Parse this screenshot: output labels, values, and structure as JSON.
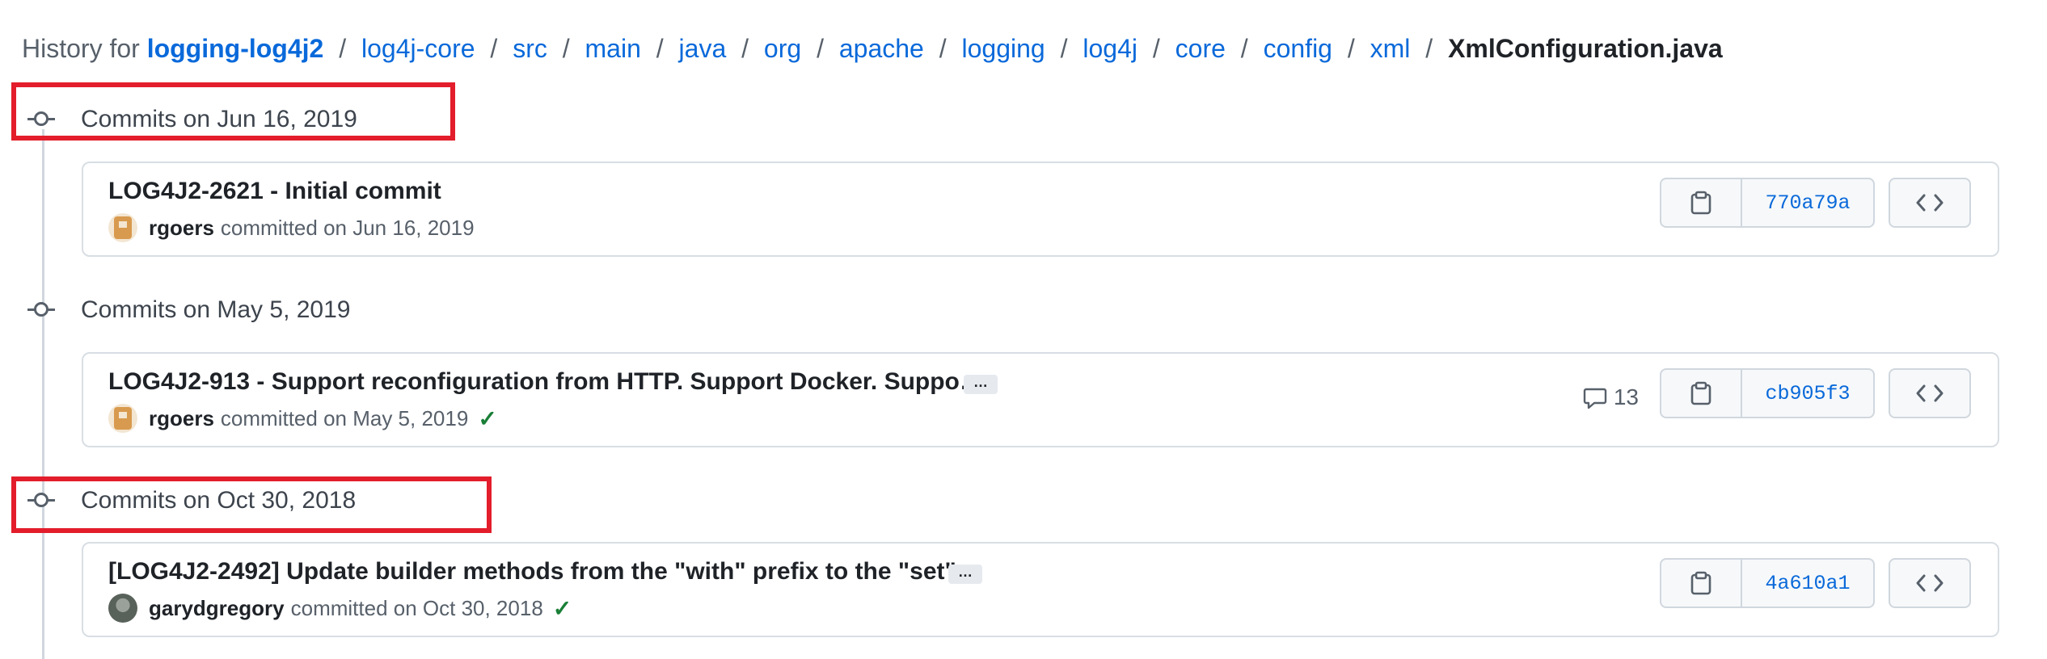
{
  "breadcrumb": {
    "prefix": "History for",
    "repo": "logging-log4j2",
    "path": [
      "log4j-core",
      "src",
      "main",
      "java",
      "org",
      "apache",
      "logging",
      "log4j",
      "core",
      "config",
      "xml"
    ],
    "file": "XmlConfiguration.java"
  },
  "groups": [
    {
      "date_label": "Commits on Jun 16, 2019",
      "highlighted": true,
      "commit": {
        "title": "LOG4J2-2621 - Initial commit",
        "author": "rgoers",
        "committed_text": "committed on Jun 16, 2019",
        "sha": "770a79a",
        "has_ellipsis": false,
        "ellipsis": "",
        "comments": "",
        "check": ""
      }
    },
    {
      "date_label": "Commits on May 5, 2019",
      "highlighted": false,
      "commit": {
        "title": "LOG4J2-913 - Support reconfiguration from HTTP. Support Docker. Suppo…",
        "author": "rgoers",
        "committed_text": "committed on May 5, 2019",
        "sha": "cb905f3",
        "has_ellipsis": true,
        "ellipsis": "…",
        "comments": "13",
        "check": "✓"
      }
    },
    {
      "date_label": "Commits on Oct 30, 2018",
      "highlighted": true,
      "commit": {
        "title": "[LOG4J2-2492] Update builder methods from the \"with\" prefix to the \"set\"",
        "author": "garydgregory",
        "committed_text": "committed on Oct 30, 2018",
        "sha": "4a610a1",
        "has_ellipsis": true,
        "ellipsis": "…",
        "comments": "",
        "check": "✓"
      }
    }
  ],
  "icons": {
    "commit": "git-commit-icon",
    "copy": "copy-icon",
    "browse": "code-icon",
    "comment": "comment-icon",
    "check": "check-icon"
  },
  "colors": {
    "link": "#0969da",
    "highlight": "#e31d2b",
    "success": "#1a7f37"
  }
}
